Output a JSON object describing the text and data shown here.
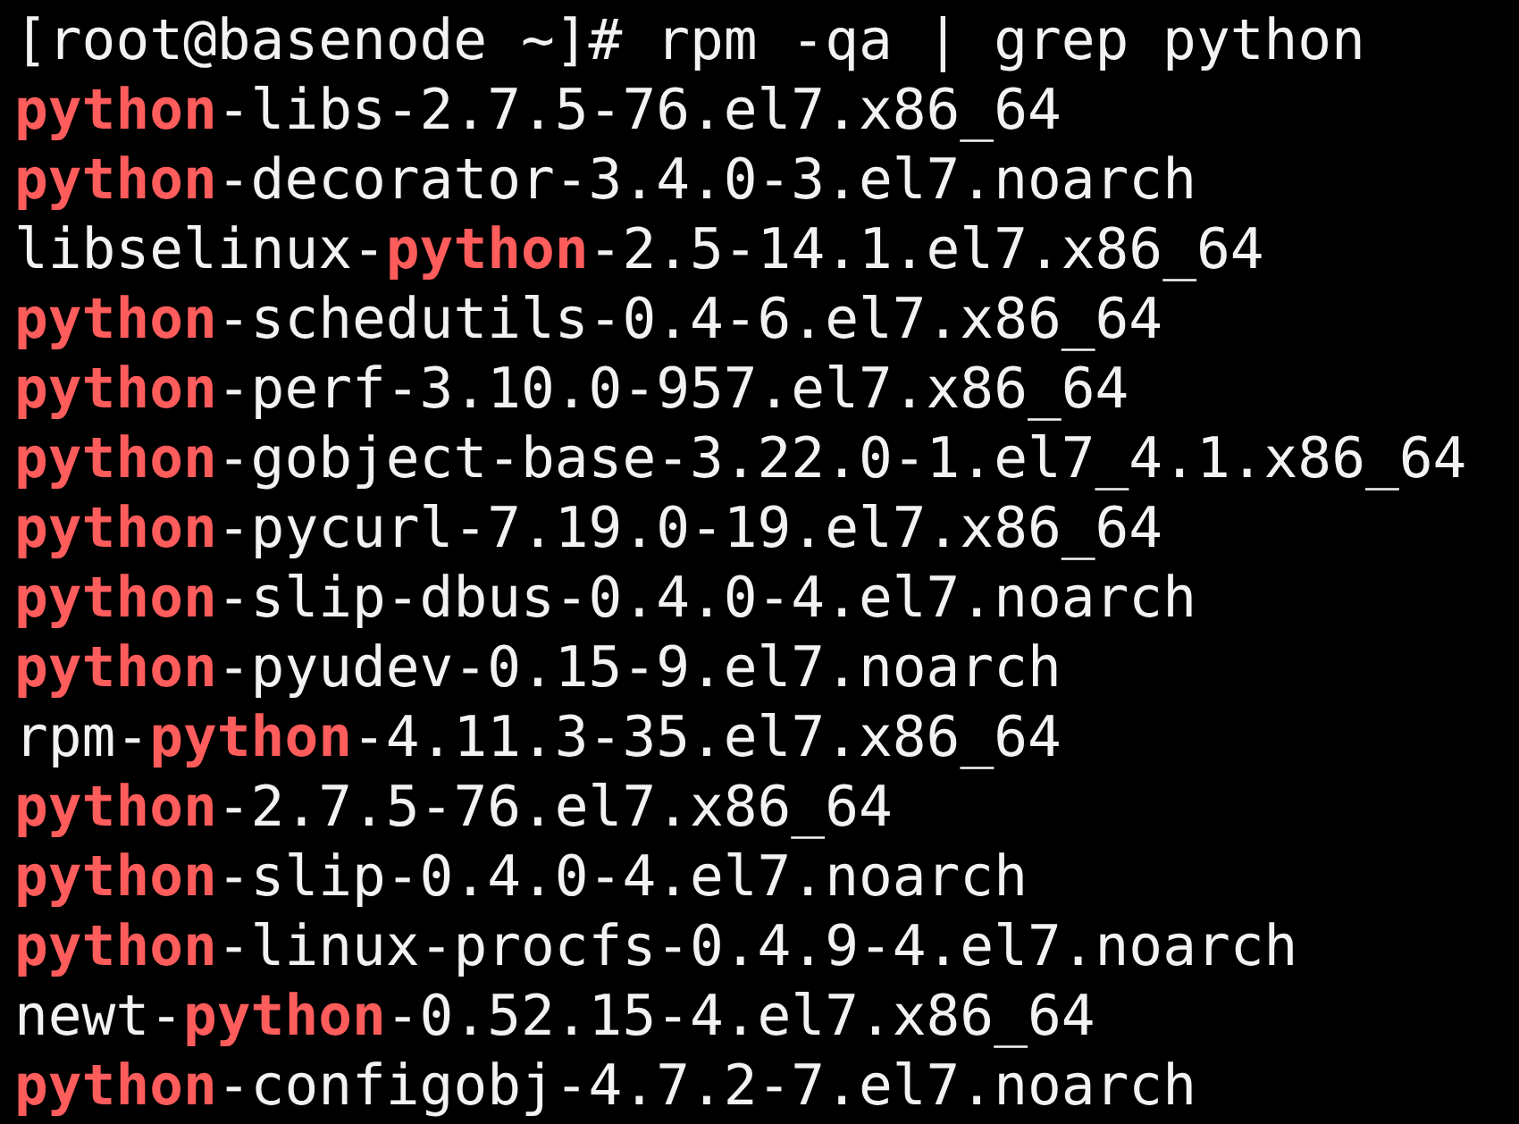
{
  "terminal": {
    "prompt": "[root@basenode ~]#",
    "command": "rpm -qa | grep python",
    "output": [
      [
        {
          "text": "python",
          "highlight": true
        },
        {
          "text": "-libs-2.7.5-76.el7.x86_64",
          "highlight": false
        }
      ],
      [
        {
          "text": "python",
          "highlight": true
        },
        {
          "text": "-decorator-3.4.0-3.el7.noarch",
          "highlight": false
        }
      ],
      [
        {
          "text": "libselinux-",
          "highlight": false
        },
        {
          "text": "python",
          "highlight": true
        },
        {
          "text": "-2.5-14.1.el7.x86_64",
          "highlight": false
        }
      ],
      [
        {
          "text": "python",
          "highlight": true
        },
        {
          "text": "-schedutils-0.4-6.el7.x86_64",
          "highlight": false
        }
      ],
      [
        {
          "text": "python",
          "highlight": true
        },
        {
          "text": "-perf-3.10.0-957.el7.x86_64",
          "highlight": false
        }
      ],
      [
        {
          "text": "python",
          "highlight": true
        },
        {
          "text": "-gobject-base-3.22.0-1.el7_4.1.x86_64",
          "highlight": false
        }
      ],
      [
        {
          "text": "python",
          "highlight": true
        },
        {
          "text": "-pycurl-7.19.0-19.el7.x86_64",
          "highlight": false
        }
      ],
      [
        {
          "text": "python",
          "highlight": true
        },
        {
          "text": "-slip-dbus-0.4.0-4.el7.noarch",
          "highlight": false
        }
      ],
      [
        {
          "text": "python",
          "highlight": true
        },
        {
          "text": "-pyudev-0.15-9.el7.noarch",
          "highlight": false
        }
      ],
      [
        {
          "text": "rpm-",
          "highlight": false
        },
        {
          "text": "python",
          "highlight": true
        },
        {
          "text": "-4.11.3-35.el7.x86_64",
          "highlight": false
        }
      ],
      [
        {
          "text": "python",
          "highlight": true
        },
        {
          "text": "-2.7.5-76.el7.x86_64",
          "highlight": false
        }
      ],
      [
        {
          "text": "python",
          "highlight": true
        },
        {
          "text": "-slip-0.4.0-4.el7.noarch",
          "highlight": false
        }
      ],
      [
        {
          "text": "python",
          "highlight": true
        },
        {
          "text": "-linux-procfs-0.4.9-4.el7.noarch",
          "highlight": false
        }
      ],
      [
        {
          "text": "newt-",
          "highlight": false
        },
        {
          "text": "python",
          "highlight": true
        },
        {
          "text": "-0.52.15-4.el7.x86_64",
          "highlight": false
        }
      ],
      [
        {
          "text": "python",
          "highlight": true
        },
        {
          "text": "-configobj-4.7.2-7.el7.noarch",
          "highlight": false
        }
      ]
    ]
  }
}
